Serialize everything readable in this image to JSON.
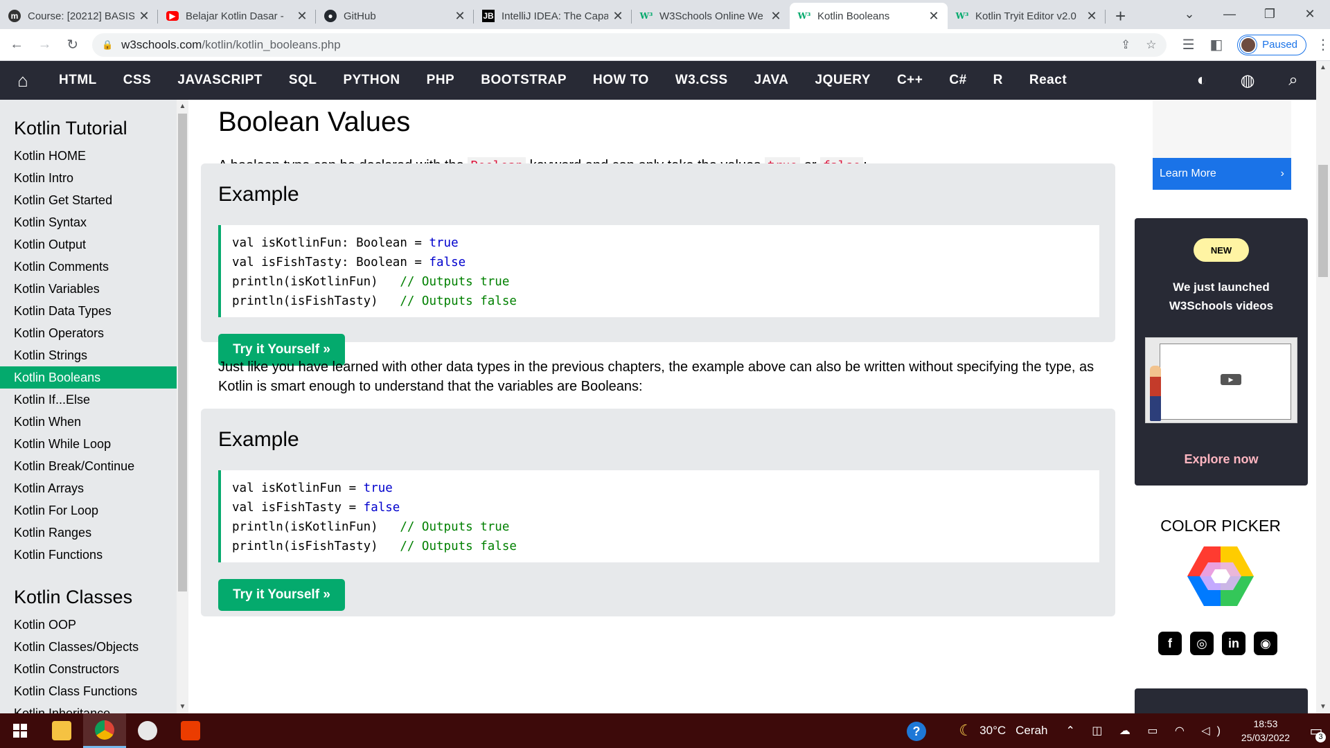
{
  "browser": {
    "tabs": [
      {
        "title": "Course: [20212] BASIS",
        "icon": "moodle-icon",
        "fav": "m"
      },
      {
        "title": "Belajar Kotlin Dasar -",
        "icon": "youtube-icon",
        "fav": "▶"
      },
      {
        "title": "GitHub",
        "icon": "github-icon",
        "fav": "●"
      },
      {
        "title": "IntelliJ IDEA: The Capa",
        "icon": "jetbrains-icon",
        "fav": "JB"
      },
      {
        "title": "W3Schools Online We",
        "icon": "w3schools-icon",
        "fav": "W³"
      },
      {
        "title": "Kotlin Booleans",
        "icon": "w3schools-icon",
        "fav": "W³",
        "active": true
      },
      {
        "title": "Kotlin Tryit Editor v2.0",
        "icon": "w3schools-icon",
        "fav": "W³"
      }
    ],
    "close_glyph": "✕",
    "new_tab_glyph": "+",
    "url_host": "w3schools.com",
    "url_path": "/kotlin/kotlin_booleans.php",
    "profile_status": "Paused"
  },
  "topnav": {
    "links": [
      "HTML",
      "CSS",
      "JAVASCRIPT",
      "SQL",
      "PYTHON",
      "PHP",
      "BOOTSTRAP",
      "HOW TO",
      "W3.CSS",
      "JAVA",
      "JQUERY",
      "C++",
      "C#",
      "R",
      "React"
    ]
  },
  "sidebar": {
    "section1_title": "Kotlin Tutorial",
    "section1_items": [
      "Kotlin HOME",
      "Kotlin Intro",
      "Kotlin Get Started",
      "Kotlin Syntax",
      "Kotlin Output",
      "Kotlin Comments",
      "Kotlin Variables",
      "Kotlin Data Types",
      "Kotlin Operators",
      "Kotlin Strings",
      "Kotlin Booleans",
      "Kotlin If...Else",
      "Kotlin When",
      "Kotlin While Loop",
      "Kotlin Break/Continue",
      "Kotlin Arrays",
      "Kotlin For Loop",
      "Kotlin Ranges",
      "Kotlin Functions"
    ],
    "active_item": "Kotlin Booleans",
    "section2_title": "Kotlin Classes",
    "section2_items": [
      "Kotlin OOP",
      "Kotlin Classes/Objects",
      "Kotlin Constructors",
      "Kotlin Class Functions",
      "Kotlin Inheritance"
    ]
  },
  "main": {
    "title": "Boolean Values",
    "intro_before": "A boolean type can be declared with the ",
    "intro_kw1": "Boolean",
    "intro_mid": " keyword and can only take the values ",
    "intro_kw2": "true",
    "intro_or": " or ",
    "intro_kw3": "false",
    "intro_end": ":",
    "example1": {
      "heading": "Example",
      "lines": [
        {
          "code": "val isKotlinFun: Boolean = ",
          "value": "true",
          "comment": ""
        },
        {
          "code": "val isFishTasty: Boolean = ",
          "value": "false",
          "comment": ""
        },
        {
          "code": "println(isKotlinFun)   ",
          "value": "",
          "comment": "// Outputs true"
        },
        {
          "code": "println(isFishTasty)   ",
          "value": "",
          "comment": "// Outputs false"
        }
      ],
      "button": "Try it Yourself »"
    },
    "paragraph": "Just like you have learned with other data types in the previous chapters, the example above can also be written without specifying the type, as Kotlin is smart enough to understand that the variables are Booleans:",
    "example2": {
      "heading": "Example",
      "lines": [
        {
          "code": "val isKotlinFun = ",
          "value": "true",
          "comment": ""
        },
        {
          "code": "val isFishTasty = ",
          "value": "false",
          "comment": ""
        },
        {
          "code": "println(isKotlinFun)   ",
          "value": "",
          "comment": "// Outputs true"
        },
        {
          "code": "println(isFishTasty)   ",
          "value": "",
          "comment": "// Outputs false"
        }
      ],
      "button": "Try it Yourself »"
    }
  },
  "rightcol": {
    "learn_more": "Learn More",
    "badge": "NEW",
    "launch_line1": "We just launched",
    "launch_line2": "W3Schools videos",
    "explore": "Explore now",
    "color_picker": "COLOR PICKER",
    "social": [
      "f",
      "◎",
      "in",
      "◉"
    ]
  },
  "taskbar": {
    "weather_temp": "30°C",
    "weather_desc": "Cerah",
    "time": "18:53",
    "date": "25/03/2022",
    "notifications": "3"
  },
  "colors": {
    "w3_green": "#04aa6d",
    "nav_dark": "#282a35",
    "sidebar_bg": "#e7e9eb",
    "keyword_red": "#dc143c",
    "code_blue": "#0000cd",
    "comment_green": "#008000"
  }
}
